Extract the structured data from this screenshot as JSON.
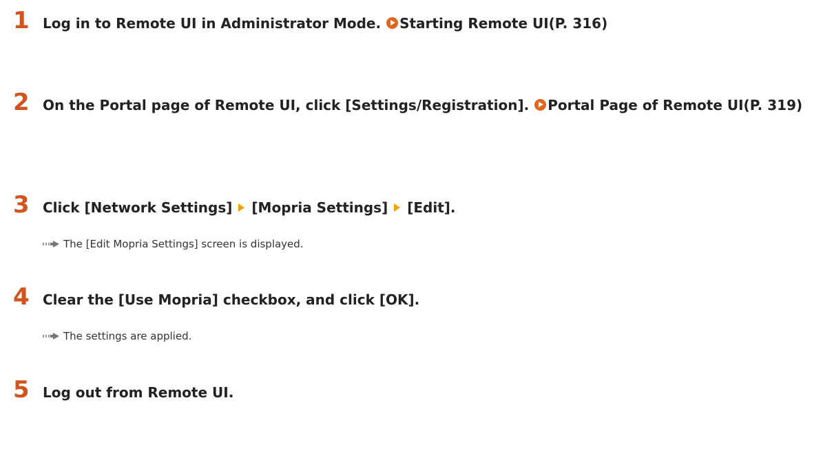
{
  "steps": [
    {
      "number": "1",
      "text": "Log in to Remote UI in Administrator Mode.",
      "link": "Starting Remote UI(P. 316)"
    },
    {
      "number": "2",
      "text": "On the Portal page of Remote UI, click [Settings/Registration].",
      "link": "Portal Page of Remote UI(P. 319)"
    },
    {
      "number": "3",
      "parts": [
        "Click [Network Settings]",
        "[Mopria Settings]",
        "[Edit]."
      ],
      "result": "The [Edit Mopria Settings] screen is displayed."
    },
    {
      "number": "4",
      "text": "Clear the [Use Mopria] checkbox, and click [OK].",
      "result": "The settings are applied."
    },
    {
      "number": "5",
      "text": "Log out from Remote UI."
    }
  ],
  "icons": {
    "link": "circle-arrow-icon",
    "menu_separator": "triangle-arrow-icon",
    "result": "result-arrow-icon"
  },
  "colors": {
    "step_number": "#d0541e",
    "link_icon": "#e0661f",
    "menu_arrow": "#f2a200"
  }
}
